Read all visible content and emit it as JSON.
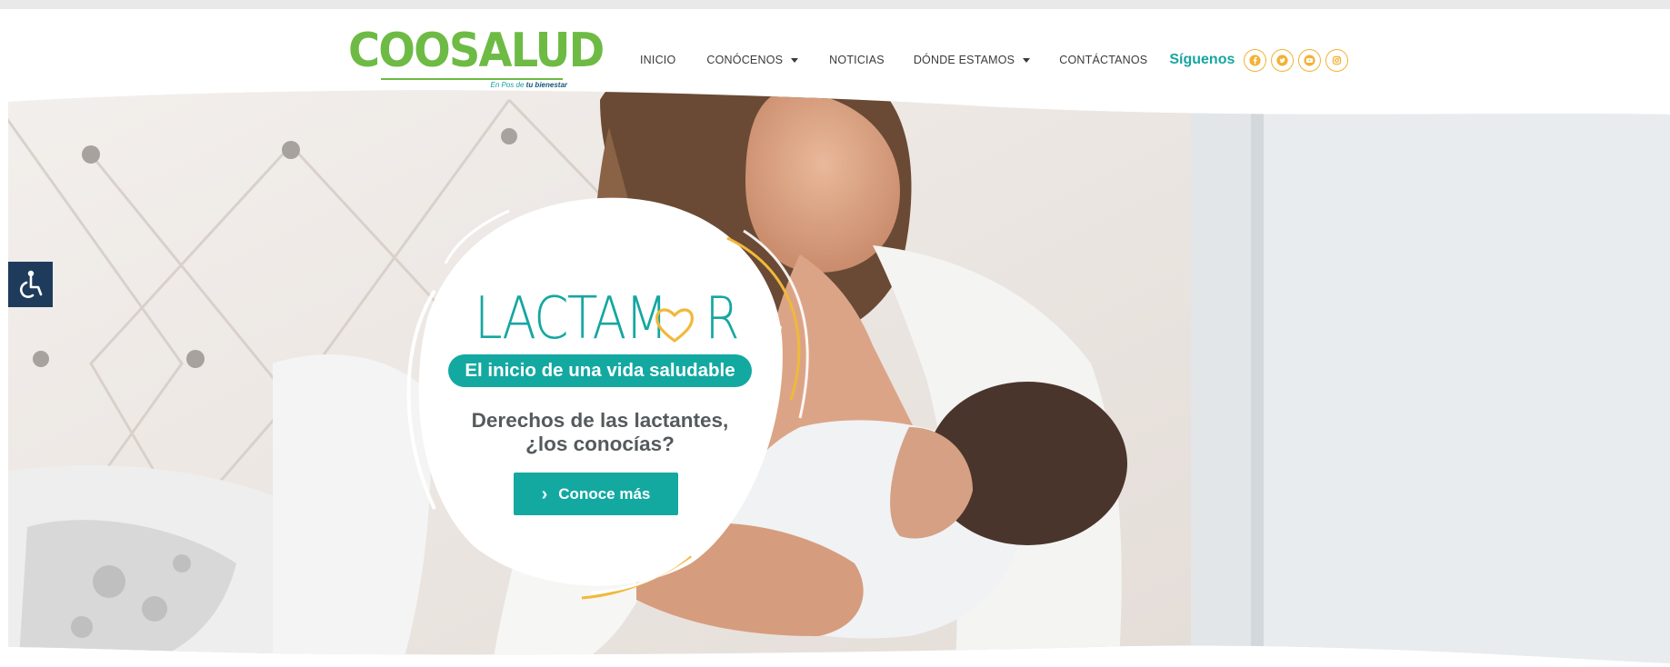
{
  "header": {
    "logo": {
      "name": "COOSALUD",
      "tagline_prefix": "En Pos de",
      "tagline_emphasis": "tu bienestar"
    },
    "nav": [
      {
        "label": "INICIO"
      },
      {
        "label": "CONÓCENOS"
      },
      {
        "label": "NOTICIAS"
      },
      {
        "label": "DÓNDE ESTAMOS"
      },
      {
        "label": "CONTÁCTANOS"
      }
    ],
    "follow_label": "Síguenos",
    "social": [
      "facebook-icon",
      "twitter-icon",
      "youtube-icon",
      "instagram-icon"
    ]
  },
  "accessibility": {
    "icon": "wheelchair-icon"
  },
  "hero": {
    "campaign_name": "LACTAMOR",
    "brand_part1": "LACTAM",
    "brand_part2": "R",
    "subtitle": "El inicio de una vida saludable",
    "headline_line1": "Derechos de las lactantes,",
    "headline_line2": "¿los conocías?",
    "cta_label": "Conoce más",
    "image_subject": "Mother breastfeeding baby in bedroom"
  },
  "colors": {
    "teal": "#13a9a1",
    "green": "#6dbb44",
    "orange": "#f2b234",
    "gold": "#f0b93a",
    "navy": "#1f3b5c",
    "gray_text": "#555a5d"
  }
}
